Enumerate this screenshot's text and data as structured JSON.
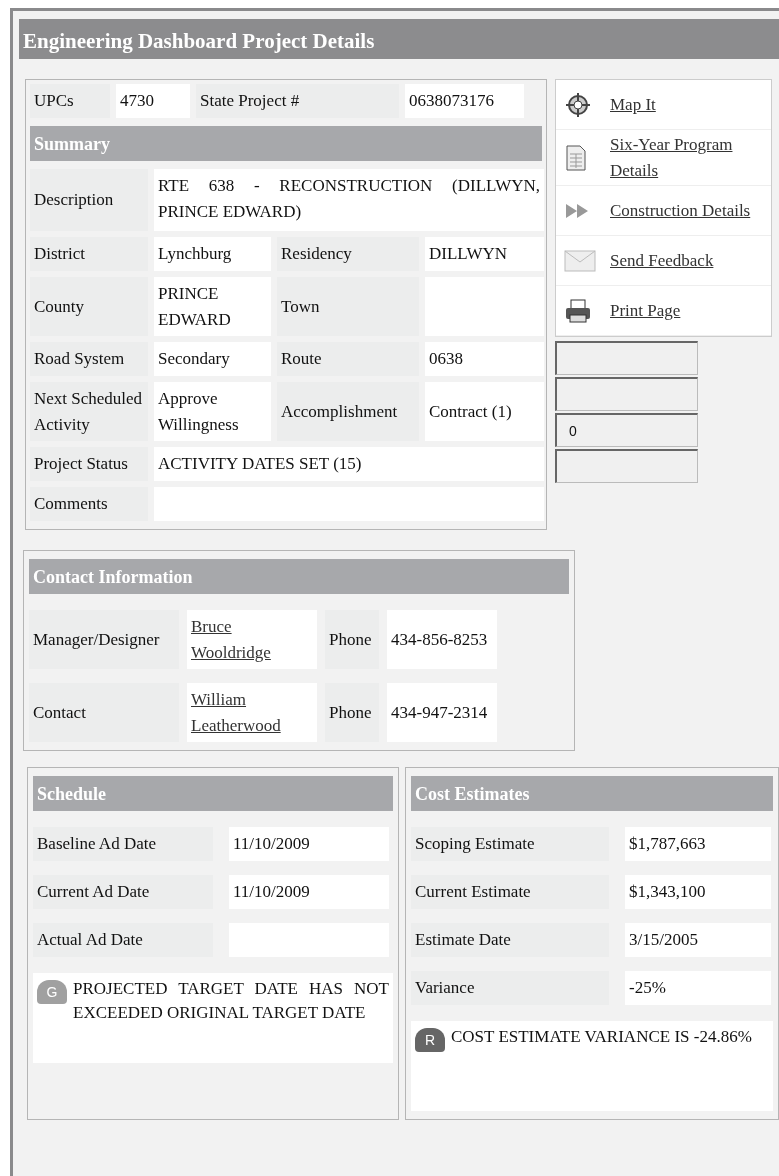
{
  "title": "Engineering Dashboard Project Details",
  "id_row": [
    {
      "label": "UPCs",
      "value": "4730"
    },
    {
      "label": "State Project #",
      "value": "0638073176"
    }
  ],
  "summary": {
    "heading": "Summary",
    "rows": [
      [
        {
          "label": "Description",
          "value": "RTE 638 - RECONSTRUCTION (DILLWYN, PRINCE EDWARD)"
        }
      ],
      [
        {
          "label": "District",
          "value": "Lynchburg"
        },
        {
          "label": "Residency",
          "value": "DILLWYN"
        }
      ],
      [
        {
          "label": "County",
          "value": "PRINCE EDWARD"
        },
        {
          "label": "Town"
        }
      ],
      [
        {
          "label": "Road System",
          "value": "Secondary"
        },
        {
          "label": "Route",
          "value": "0638"
        }
      ],
      [
        {
          "label": "Next Scheduled Activity",
          "value": "Approve Willingness"
        },
        {
          "label": "Accomplishment",
          "value": "Contract (1)"
        }
      ],
      [
        {
          "label": "Project Status",
          "value": "ACTIVITY DATES SET (15)"
        }
      ],
      [
        {
          "label": "Comments"
        }
      ]
    ]
  },
  "links": [
    {
      "label": "Map It",
      "kind": "map"
    },
    {
      "label": "Six-Year Program Details",
      "kind": "document"
    },
    {
      "label": "Construction Details",
      "kind": "arrows"
    },
    {
      "label": "Send Feedback",
      "kind": "mail"
    },
    {
      "label": "Print Page",
      "kind": "print"
    }
  ],
  "side_fields": [
    {
      "kind": "empty"
    },
    {
      "kind": "empty"
    },
    {
      "kind": "value",
      "value": "0"
    },
    {
      "kind": "empty"
    }
  ],
  "contact": {
    "heading": "Contact Information",
    "rows": [
      {
        "label": "Manager/Designer",
        "name": "Bruce Wooldridge",
        "phone_label": "Phone",
        "phone": "434-856-8253"
      },
      {
        "label": "Contact",
        "name": "William Leatherwood",
        "phone_label": "Phone",
        "phone": "434-947-2314"
      }
    ]
  },
  "schedule": {
    "heading": "Schedule",
    "rows": [
      {
        "label": "Baseline Ad Date",
        "value": "11/10/2009"
      },
      {
        "label": "Current Ad Date",
        "value": "11/10/2009"
      },
      {
        "label": "Actual Ad Date"
      }
    ],
    "note": {
      "indicator": "G",
      "kind": "light",
      "text": "PROJECTED TARGET DATE HAS NOT EXCEEDED ORIGINAL TARGET DATE"
    }
  },
  "costs": {
    "heading": "Cost Estimates",
    "rows": [
      {
        "label": "Scoping Estimate",
        "value": "$1,787,663"
      },
      {
        "label": "Current Estimate",
        "value": "$1,343,100"
      },
      {
        "label": "Estimate Date",
        "value": "3/15/2005"
      },
      {
        "label": "Variance",
        "value": "-25%"
      }
    ],
    "note": {
      "indicator": "R",
      "kind": "dark",
      "text": "COST ESTIMATE VARIANCE IS -24.86%"
    }
  }
}
